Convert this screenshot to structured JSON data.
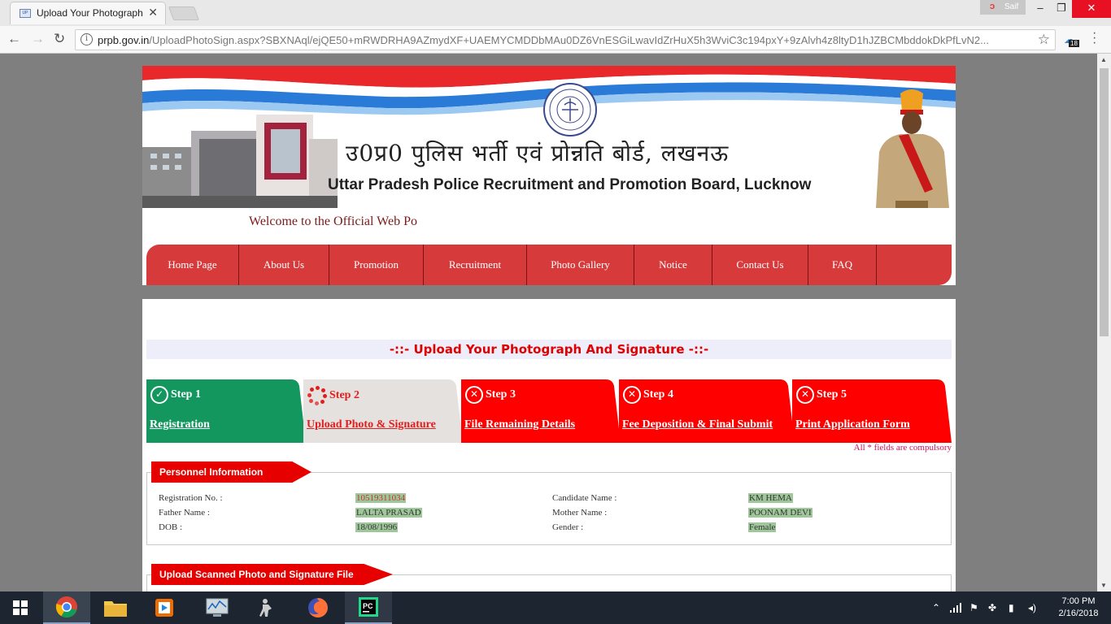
{
  "browser": {
    "tab_title": "Upload Your Photograph",
    "favicon_text": "UP",
    "user_name": "Saif",
    "url_host": "prpb.gov.in",
    "url_path": "/UploadPhotoSign.aspx?SBXNAql/ejQE50+mRWDRHA9AZmydXF+UAEMYCMDDbMAu0DZ6VnESGiLwavIdZrHuX5h3WviC3c194pxY+9zAlvh4z8ltyD1hJZBCMbddokDkPfLvN2...",
    "extension_badge": "18"
  },
  "header": {
    "hindi_title": "उ0प्र0 पुलिस भर्ती एवं प्रोन्नति बोर्ड, लखनऊ",
    "english_title": "Uttar Pradesh Police Recruitment and Promotion Board, Lucknow",
    "welcome": "Welcome to the Official Web Po"
  },
  "nav": [
    "Home Page",
    "About Us",
    "Promotion",
    "Recruitment",
    "Photo Gallery",
    "Notice",
    "Contact Us",
    "FAQ"
  ],
  "section_title": "-::- Upload Your Photograph And Signature -::-",
  "steps": [
    {
      "head": "Step 1",
      "link": "Registration",
      "status": "done",
      "color": "#13975f"
    },
    {
      "head": "Step 2",
      "link": "Upload Photo & Signature",
      "status": "current",
      "color": "#e4e1df"
    },
    {
      "head": "Step 3",
      "link": "File Remaining Details",
      "status": "pending",
      "color": "#fe0000"
    },
    {
      "head": "Step 4",
      "link": "Fee Deposition & Final Submit",
      "status": "pending",
      "color": "#fe0000"
    },
    {
      "head": "Step 5",
      "link": "Print Application Form",
      "status": "pending",
      "color": "#fe0000"
    }
  ],
  "compulsory_note": "All * fields are compulsory",
  "personnel": {
    "legend": "Personnel Information",
    "registration_label": "Registration No. :",
    "registration_value": "10519311034",
    "candidate_label": "Candidate Name :",
    "candidate_value": "KM HEMA",
    "father_label": "Father Name :",
    "father_value": "LALTA PRASAD",
    "mother_label": "Mother Name :",
    "mother_value": "POONAM DEVI",
    "dob_label": "DOB :",
    "dob_value": "18/08/1996",
    "gender_label": "Gender :",
    "gender_value": "Female"
  },
  "upload_section": {
    "legend": "Upload Scanned Photo and Signature File"
  },
  "taskbar": {
    "time": "7:00 PM",
    "date": "2/16/2018"
  },
  "colors": {
    "nav_red": "#d63a3a",
    "step_green": "#13975f",
    "step_red": "#fe0000",
    "legend_red": "#e60000"
  }
}
